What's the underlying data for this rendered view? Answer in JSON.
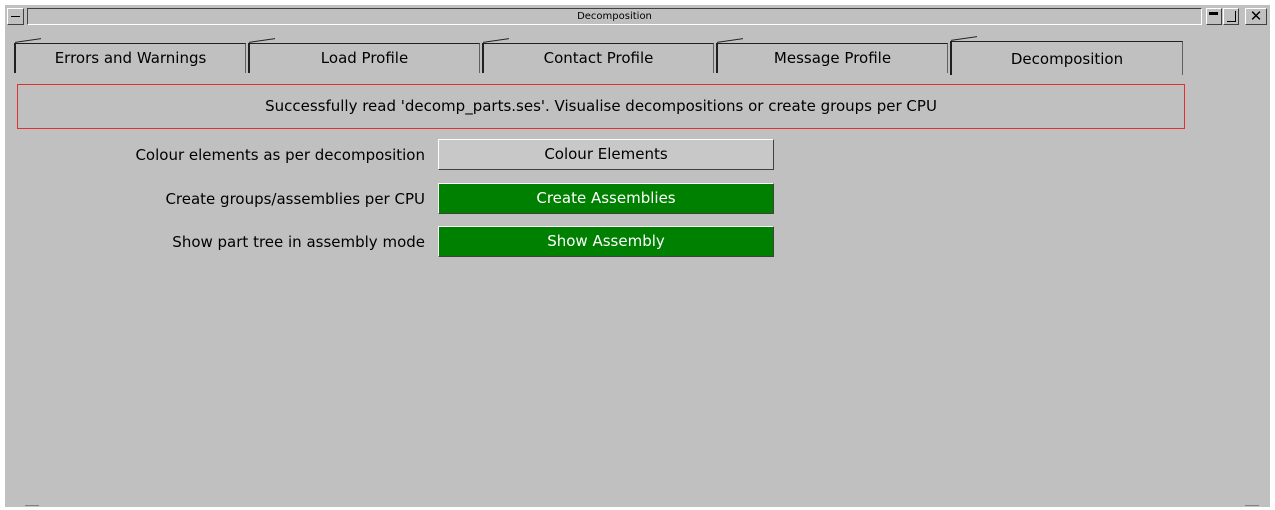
{
  "window": {
    "title": "Decomposition",
    "close_glyph": "✕"
  },
  "tabs": [
    {
      "label": "Errors and Warnings",
      "active": false
    },
    {
      "label": "Load Profile",
      "active": false
    },
    {
      "label": "Contact Profile",
      "active": false
    },
    {
      "label": "Message Profile",
      "active": false
    },
    {
      "label": "Decomposition",
      "active": true
    }
  ],
  "message": {
    "text": "Successfully read 'decomp_parts.ses'. Visualise decompositions or create groups per CPU",
    "border_color": "#e03030"
  },
  "rows": [
    {
      "label": "Colour elements as per decomposition",
      "button": "Colour Elements",
      "style": "grey"
    },
    {
      "label": "Create groups/assemblies per CPU",
      "button": "Create Assemblies",
      "style": "green"
    },
    {
      "label": "Show part tree in assembly mode",
      "button": "Show Assembly",
      "style": "green"
    }
  ],
  "colors": {
    "background": "#c0c0c0",
    "green_button": "#008000"
  }
}
